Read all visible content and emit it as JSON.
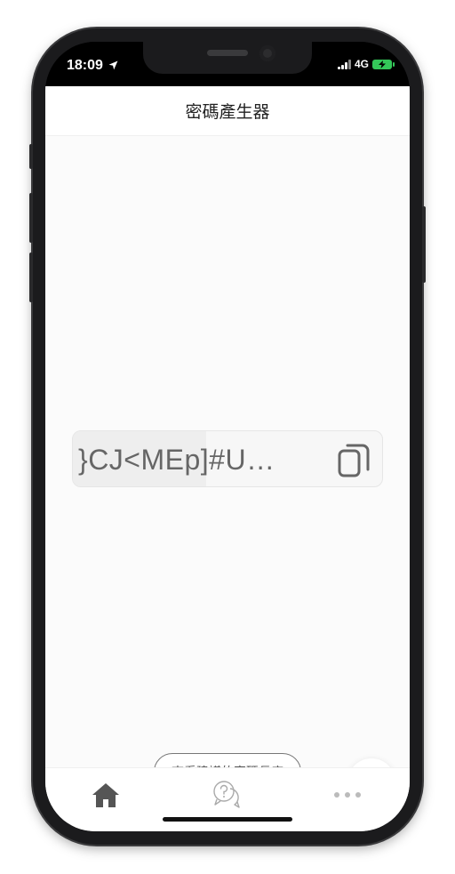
{
  "status_bar": {
    "time": "18:09",
    "network": "4G"
  },
  "nav": {
    "title": "密碼產生器"
  },
  "password": {
    "value": "}CJ<MEp]#U…"
  },
  "actions": {
    "suggest_label": "查看建議的密碼長度"
  },
  "tabs": [
    {
      "icon": "home-icon",
      "active": true
    },
    {
      "icon": "help-chat-icon",
      "active": false
    },
    {
      "icon": "more-icon",
      "active": false
    }
  ],
  "colors": {
    "battery": "#34c759",
    "text_primary": "#222222",
    "icon_gray": "#666666"
  }
}
